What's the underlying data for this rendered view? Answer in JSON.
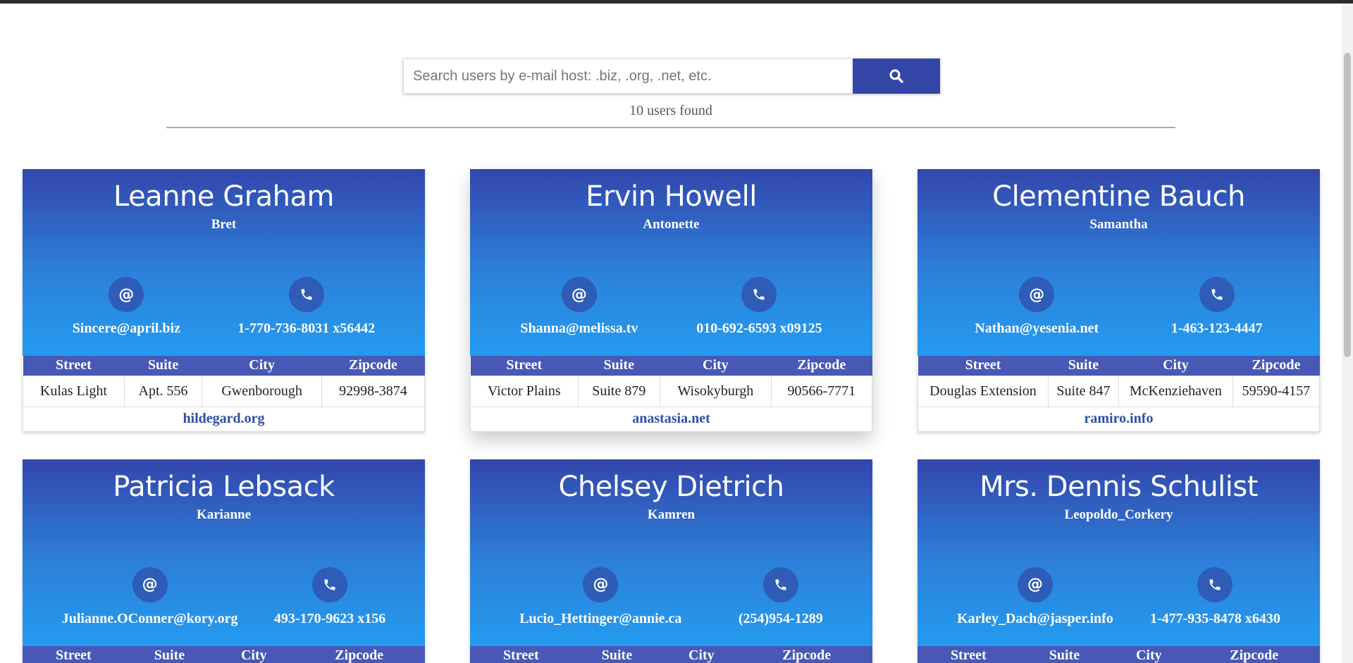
{
  "search": {
    "placeholder": "Search users by e-mail host: .biz, .org, .net, etc.",
    "value": ""
  },
  "results": {
    "count_text": "10 users found"
  },
  "table_headers": [
    "Street",
    "Suite",
    "City",
    "Zipcode"
  ],
  "icons": {
    "email": "at-sign-icon",
    "phone": "phone-icon",
    "search": "search-icon"
  },
  "colors": {
    "accent": "#3346a8",
    "card_gradient_top": "#3346ac",
    "card_gradient_bottom": "#239bf0",
    "table_header": "#4858b6",
    "link": "#2f4fa8"
  },
  "users": [
    {
      "name": "Leanne Graham",
      "username": "Bret",
      "email": "Sincere@april.biz",
      "phone": "1-770-736-8031 x56442",
      "street": "Kulas Light",
      "suite": "Apt. 556",
      "city": "Gwenborough",
      "zipcode": "92998-3874",
      "website": "hildegard.org"
    },
    {
      "name": "Ervin Howell",
      "username": "Antonette",
      "email": "Shanna@melissa.tv",
      "phone": "010-692-6593 x09125",
      "street": "Victor Plains",
      "suite": "Suite 879",
      "city": "Wisokyburgh",
      "zipcode": "90566-7771",
      "website": "anastasia.net"
    },
    {
      "name": "Clementine Bauch",
      "username": "Samantha",
      "email": "Nathan@yesenia.net",
      "phone": "1-463-123-4447",
      "street": "Douglas Extension",
      "suite": "Suite 847",
      "city": "McKenziehaven",
      "zipcode": "59590-4157",
      "website": "ramiro.info"
    },
    {
      "name": "Patricia Lebsack",
      "username": "Karianne",
      "email": "Julianne.OConner@kory.org",
      "phone": "493-170-9623 x156"
    },
    {
      "name": "Chelsey Dietrich",
      "username": "Kamren",
      "email": "Lucio_Hettinger@annie.ca",
      "phone": "(254)954-1289"
    },
    {
      "name": "Mrs. Dennis Schulist",
      "username": "Leopoldo_Corkery",
      "email": "Karley_Dach@jasper.info",
      "phone": "1-477-935-8478 x6430"
    }
  ]
}
